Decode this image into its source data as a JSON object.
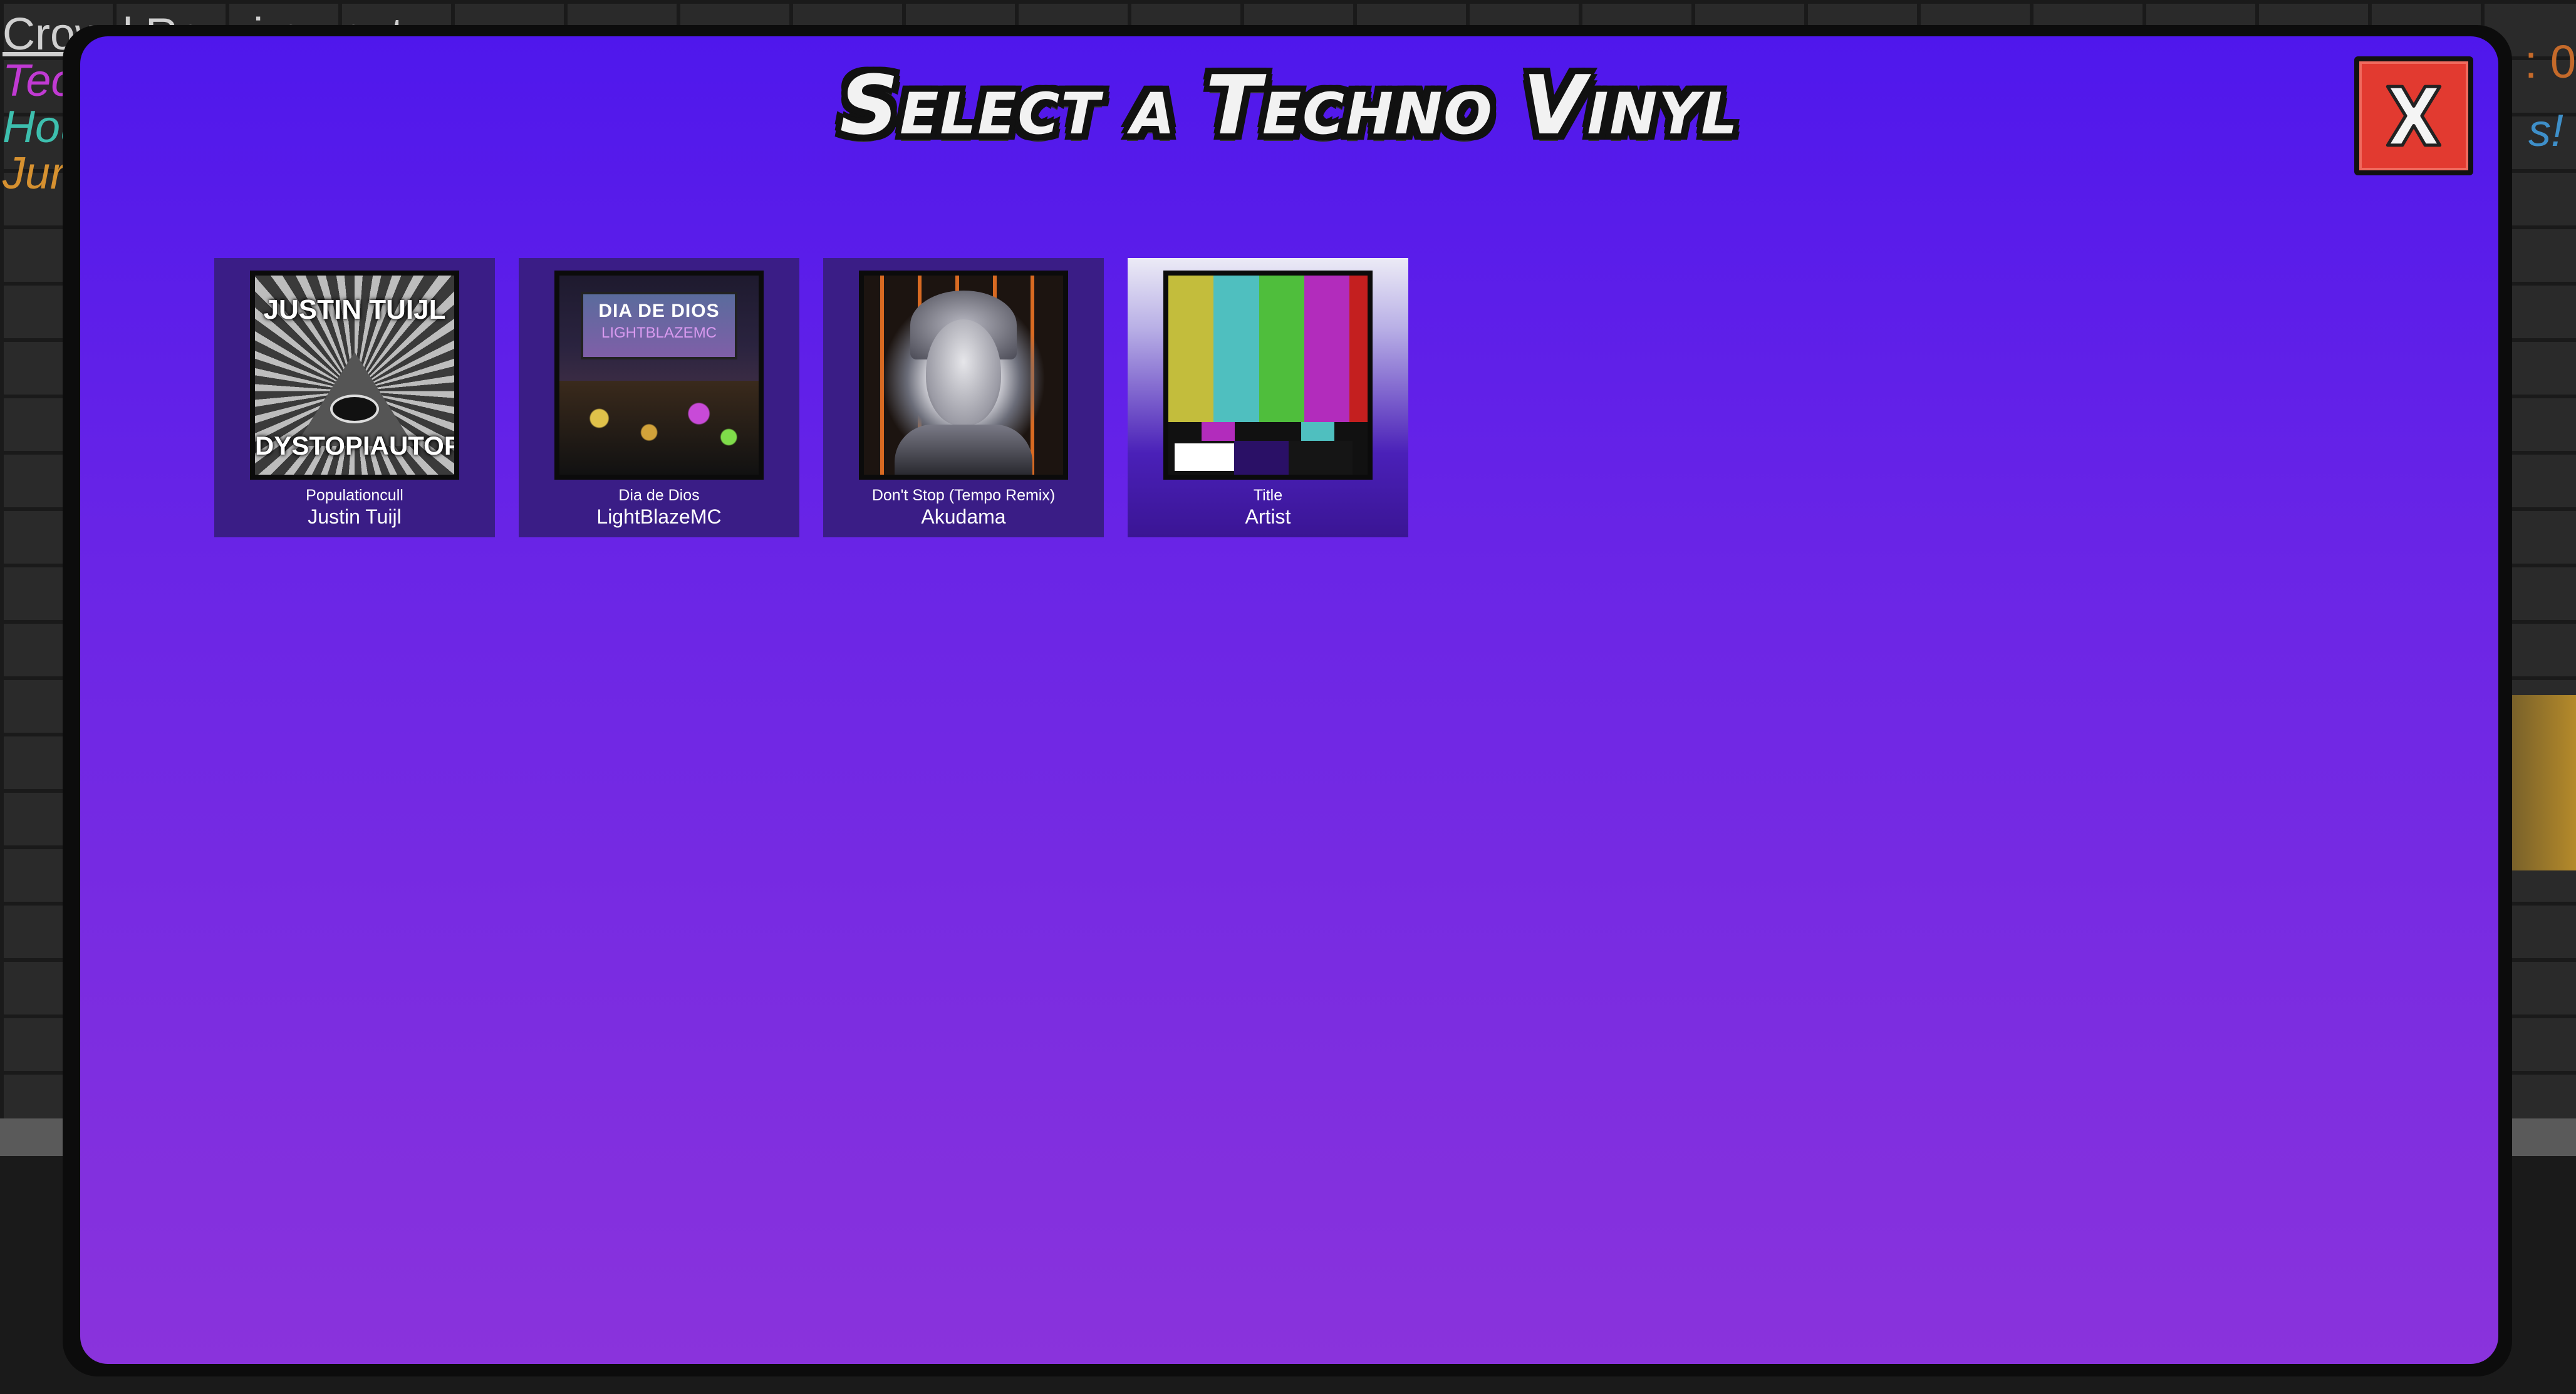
{
  "background": {
    "crowd_label": "Crowd Requirements",
    "genre_lines": [
      "Tec",
      "Hou",
      "Jur"
    ],
    "right_top": ": 0",
    "right_mid": "s!"
  },
  "modal": {
    "title": "Select a Techno Vinyl",
    "close_label": "X"
  },
  "vinyls": [
    {
      "title": "Populationcull",
      "artist": "Justin Tuijl",
      "cover_top": "JUSTIN TUIJL",
      "cover_bottom": "DYSTOPIAUTOPIA",
      "selected": false
    },
    {
      "title": "Dia de Dios",
      "artist": "LightBlazeMC",
      "cover_top": "DIA DE DIOS",
      "cover_bottom": "LIGHTBLAZEMC",
      "selected": false
    },
    {
      "title": "Don't Stop (Tempo Remix)",
      "artist": "Akudama",
      "selected": false
    },
    {
      "title": "Title",
      "artist": "Artist",
      "selected": true
    }
  ],
  "colors": {
    "modal_top": "#4f17ec",
    "modal_bottom": "#8a33dc",
    "card_bg": "#3a1d86",
    "close_red": "#e23a30",
    "color_bars": [
      "#c3bd3c",
      "#4fbfbf",
      "#4fbe3c",
      "#b22cbc",
      "#c41f1f"
    ]
  }
}
